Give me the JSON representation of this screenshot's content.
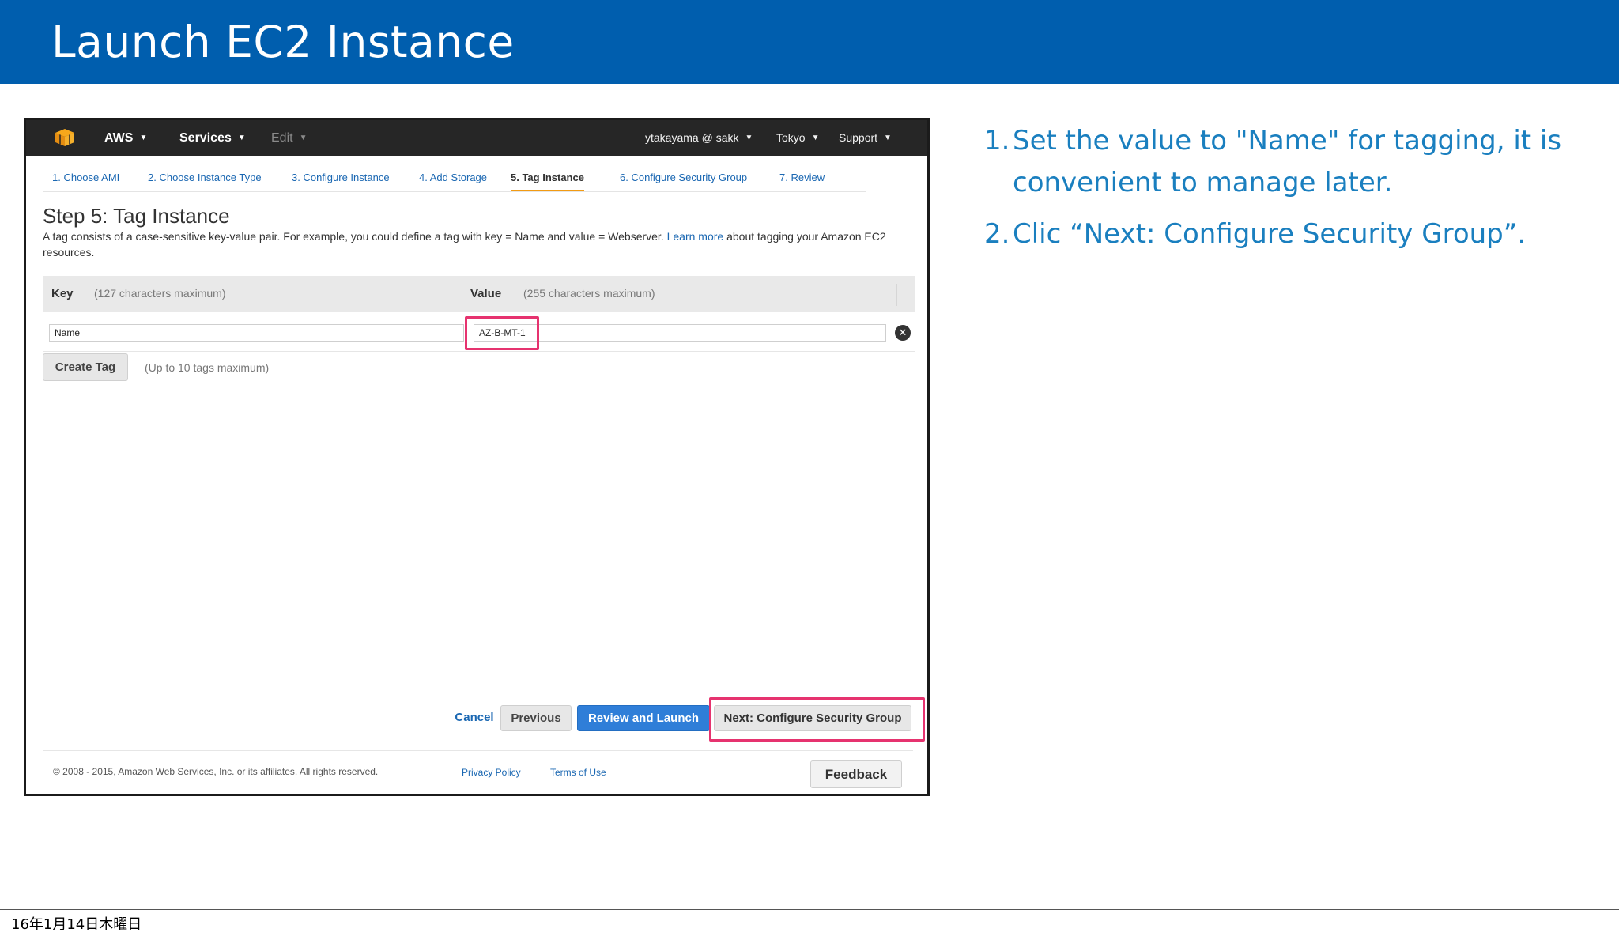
{
  "slide": {
    "title": "Launch EC2 Instance",
    "date": "16年1月14日木曜日"
  },
  "aws": {
    "nav": {
      "brand": "AWS",
      "services": "Services",
      "edit": "Edit",
      "account": "ytakayama @ sakk",
      "region": "Tokyo",
      "support": "Support"
    },
    "steps": [
      {
        "label": "1. Choose AMI"
      },
      {
        "label": "2. Choose Instance Type"
      },
      {
        "label": "3. Configure Instance"
      },
      {
        "label": "4. Add Storage"
      },
      {
        "label": "5. Tag Instance",
        "active": true
      },
      {
        "label": "6. Configure Security Group"
      },
      {
        "label": "7. Review"
      }
    ],
    "heading": "Step 5: Tag Instance",
    "description_pre": "A tag consists of a case-sensitive key-value pair. For example, you could define a tag with key = Name and value = Webserver. ",
    "learn_more": "Learn more",
    "description_post": " about tagging your Amazon EC2 resources.",
    "table": {
      "key_header": "Key",
      "key_hint": "(127 characters maximum)",
      "value_header": "Value",
      "value_hint": "(255 characters maximum)",
      "rows": [
        {
          "key": "Name",
          "value": "AZ-B-MT-1"
        }
      ]
    },
    "create_tag": "Create Tag",
    "create_tag_hint": "(Up to 10 tags maximum)",
    "buttons": {
      "cancel": "Cancel",
      "previous": "Previous",
      "review": "Review and Launch",
      "next": "Next: Configure Security Group"
    },
    "footer": {
      "copyright": "© 2008 - 2015, Amazon Web Services, Inc. or its affiliates. All rights reserved.",
      "privacy": "Privacy Policy",
      "terms": "Terms of Use",
      "feedback": "Feedback"
    },
    "colors": {
      "nav_bg": "#262626",
      "primary_button": "#2f7ed8",
      "active_step_underline": "#f29b13",
      "highlight": "#e6336f"
    }
  },
  "instructions": [
    {
      "num": "1.",
      "text": "Set the value to \"Name\" for tagging, it is convenient to manage later."
    },
    {
      "num": "2.",
      "text": "Clic “Next: Configure Security Group”."
    }
  ],
  "colors": {
    "banner": "#005eae",
    "instruction_text": "#1a7fbf"
  }
}
